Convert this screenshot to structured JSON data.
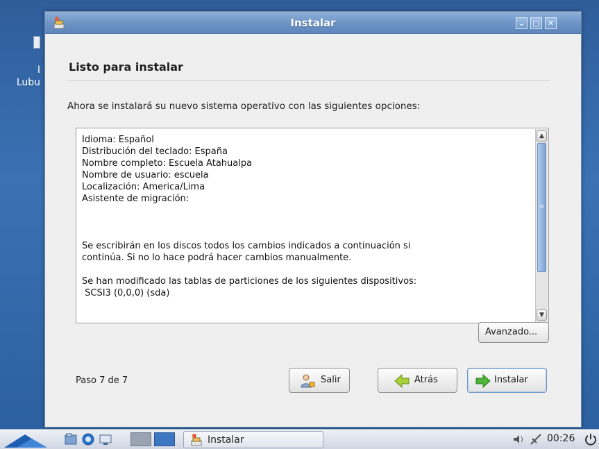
{
  "desktop": {
    "icon_label": "I\nLubu"
  },
  "window": {
    "title": "Instalar",
    "controls": {
      "minimize": "–",
      "maximize": "□",
      "close": "✕"
    }
  },
  "page": {
    "heading": "Listo para instalar",
    "intro": "Ahora se instalará su nuevo sistema operativo con las siguientes opciones:"
  },
  "summary": {
    "lines": [
      "Idioma: Español",
      "Distribución del teclado: España",
      "Nombre completo: Escuela Atahualpa",
      "Nombre de usuario: escuela",
      "Localización: America/Lima",
      "Asistente de migración:",
      "",
      "",
      "",
      "Se escribirán en los discos todos los cambios indicados a continuación si",
      "continúa. Si no lo hace podrá hacer cambios manualmente.",
      "",
      "Se han modificado las tablas de particiones de los siguientes dispositivos:",
      " SCSI3 (0,0,0) (sda)",
      "",
      ""
    ]
  },
  "buttons": {
    "advanced": "Avanzado...",
    "quit": "Salir",
    "back": "Atrás",
    "install": "Instalar"
  },
  "step_label": "Paso 7 de 7",
  "taskbar": {
    "task_label": "Instalar",
    "clock": "00:26",
    "icons": [
      "start-menu-icon",
      "file-manager-icon",
      "browser-icon",
      "show-desktop-icon",
      "workspace-1-icon",
      "workspace-2-icon",
      "volume-icon",
      "network-icon",
      "power-icon"
    ]
  },
  "colors": {
    "titlebar": "#6e95c6",
    "window_bg": "#efefef",
    "install_arrow": "#4fb43a",
    "back_arrow": "#a9cf3a"
  }
}
